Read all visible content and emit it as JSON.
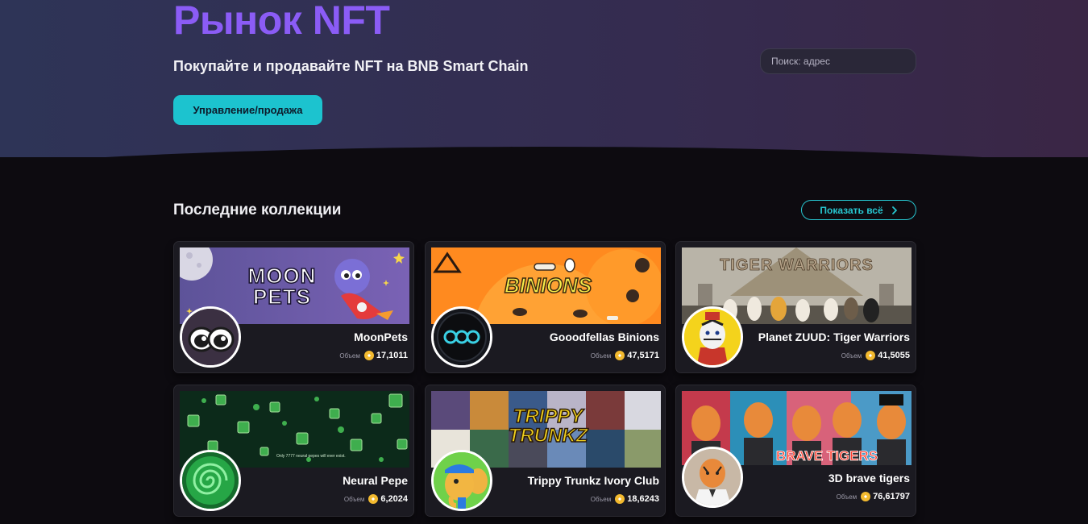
{
  "hero": {
    "title": "Рынок NFT",
    "subtitle": "Покупайте и продавайте NFT на BNB Smart Chain",
    "manage_button": "Управление/продажа",
    "search_placeholder": "Поиск: адрес"
  },
  "collections_section": {
    "title": "Последние коллекции",
    "show_all": "Показать всё"
  },
  "collections": [
    {
      "name": "MoonPets",
      "volume_label": "Объем",
      "volume": "17,1011",
      "banner_text": "MOON PETS"
    },
    {
      "name": "Gooodfellas Binions",
      "volume_label": "Объем",
      "volume": "47,5171",
      "banner_text": "BINIONS",
      "avatar_text": "OOO"
    },
    {
      "name": "Planet ZUUD: Tiger Warriors",
      "volume_label": "Объем",
      "volume": "41,5055",
      "banner_text": "TIGER WARRIORS"
    },
    {
      "name": "Neural Pepe",
      "volume_label": "Объем",
      "volume": "6,2024",
      "banner_text": "Only 7777 neural pepes will ever exist."
    },
    {
      "name": "Trippy Trunkz Ivory Club",
      "volume_label": "Объем",
      "volume": "18,6243",
      "banner_text": "TRIPPY TRUNKZ"
    },
    {
      "name": "3D brave tigers",
      "volume_label": "Объем",
      "volume": "76,61797",
      "banner_text": "BRAVE TIGERS"
    }
  ],
  "colors": {
    "accent_purple": "#8b5cf6",
    "accent_cyan": "#1cc3cf",
    "coin_gold": "#f3ba2f"
  },
  "icons": {
    "show_all": "chevron-right-icon",
    "currency": "bnb-coin-icon"
  }
}
